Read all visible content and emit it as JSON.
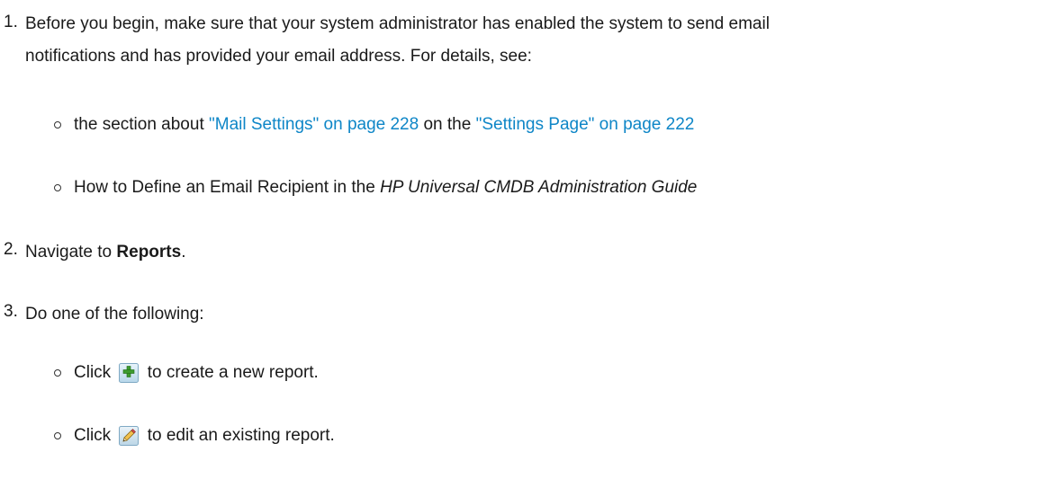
{
  "steps": [
    {
      "number": "1.",
      "line1": "Before you begin, make sure that your system administrator has enabled the system to send email",
      "line2": "notifications and has provided your email address. For details, see:",
      "bullets": [
        {
          "pre": "the section about ",
          "link1": "\"Mail Settings\" on page 228",
          "mid": " on the ",
          "link2": "\"Settings Page\" on page 222"
        },
        {
          "pre": "How to Define an Email Recipient in the ",
          "italic": "HP Universal CMDB Administration Guide"
        }
      ]
    },
    {
      "number": "2.",
      "pre": "Navigate to ",
      "bold": "Reports",
      "post": "."
    },
    {
      "number": "3.",
      "text": "Do one of the following:",
      "bullets": [
        {
          "pre": "Click ",
          "icon": "add-icon",
          "post": " to create a new report."
        },
        {
          "pre": "Click ",
          "icon": "edit-pencil-icon",
          "post": " to edit an existing report."
        }
      ]
    }
  ],
  "colors": {
    "link": "#0e86c7",
    "text": "#1a1a1a"
  }
}
